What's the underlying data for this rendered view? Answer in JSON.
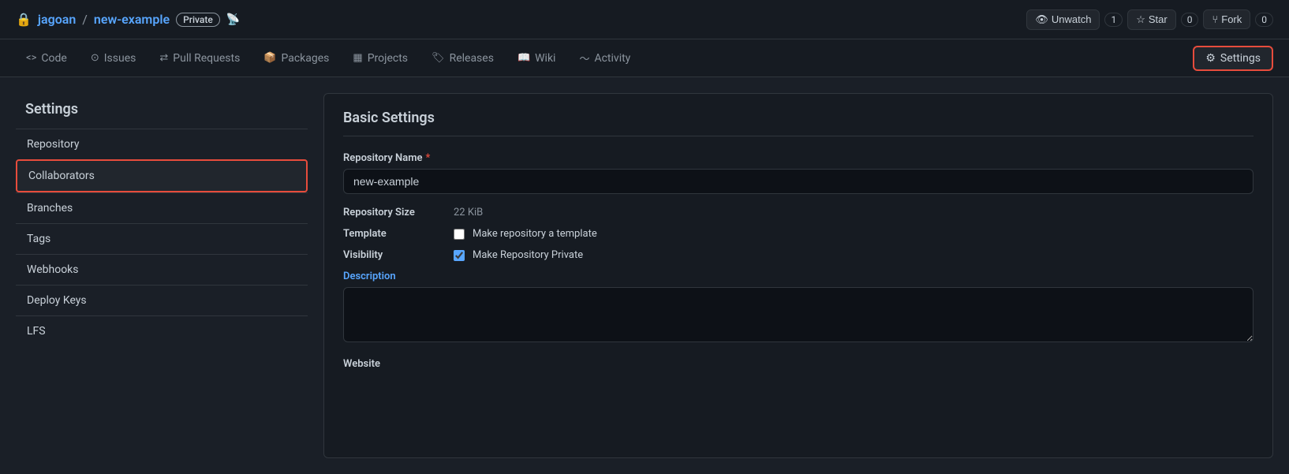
{
  "header": {
    "lock_icon": "🔒",
    "repo_owner": "jagoan",
    "separator": "/",
    "repo_name": "new-example",
    "private_badge": "Private",
    "rss_icon": "📡",
    "actions": {
      "unwatch_label": "Unwatch",
      "unwatch_count": "1",
      "star_label": "Star",
      "star_count": "0",
      "fork_label": "Fork",
      "fork_count": "0"
    }
  },
  "nav": {
    "tabs": [
      {
        "icon": "<>",
        "label": "Code"
      },
      {
        "icon": "⊙",
        "label": "Issues"
      },
      {
        "icon": "⇄",
        "label": "Pull Requests"
      },
      {
        "icon": "📦",
        "label": "Packages"
      },
      {
        "icon": "▦",
        "label": "Projects"
      },
      {
        "icon": "🏷",
        "label": "Releases"
      },
      {
        "icon": "📖",
        "label": "Wiki"
      },
      {
        "icon": "〜",
        "label": "Activity"
      }
    ],
    "settings_tab": "Settings",
    "settings_icon": "⚙"
  },
  "sidebar": {
    "title": "Settings",
    "items": [
      {
        "label": "Repository"
      },
      {
        "label": "Collaborators",
        "active": true
      },
      {
        "label": "Branches"
      },
      {
        "label": "Tags"
      },
      {
        "label": "Webhooks"
      },
      {
        "label": "Deploy Keys"
      },
      {
        "label": "LFS"
      }
    ]
  },
  "content": {
    "title": "Basic Settings",
    "repo_name_label": "Repository Name",
    "repo_name_required": "*",
    "repo_name_value": "new-example",
    "repo_size_label": "Repository Size",
    "repo_size_value": "22 KiB",
    "template_label": "Template",
    "template_checkbox_checked": false,
    "template_text": "Make repository a template",
    "visibility_label": "Visibility",
    "visibility_checkbox_checked": true,
    "visibility_text": "Make Repository Private",
    "description_label": "Description",
    "description_value": "",
    "website_label": "Website"
  }
}
